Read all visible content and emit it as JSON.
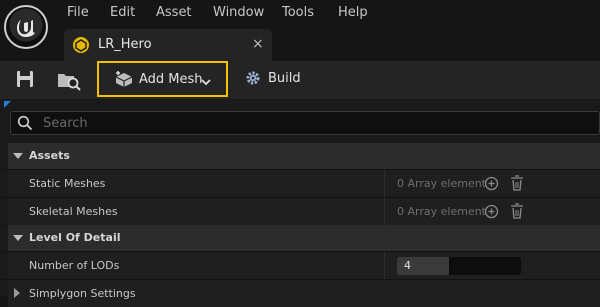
{
  "menu": {
    "items": [
      "File",
      "Edit",
      "Asset",
      "Window",
      "Tools",
      "Help"
    ]
  },
  "tab": {
    "label": "LR_Hero",
    "close": "×"
  },
  "toolbar": {
    "add_mesh_label": "Add Mesh",
    "build_label": "Build"
  },
  "details": {
    "search_placeholder": "Search",
    "sections": {
      "assets": "Assets",
      "lod": "Level Of Detail"
    },
    "rows": {
      "static_meshes": {
        "label": "Static Meshes",
        "value": "0 Array element"
      },
      "skeletal_meshes": {
        "label": "Skeletal Meshes",
        "value": "0 Array element"
      },
      "number_of_lods": {
        "label": "Number of LODs",
        "value": "4",
        "slider_fraction": 0.42
      },
      "simplygon": {
        "label": "Simplygon Settings"
      }
    }
  },
  "colors": {
    "highlight": "#f2c200",
    "tab_icon": "#e6b800",
    "accent_corner": "#2b7bd8"
  },
  "icons": [
    "unreal-logo-icon",
    "save-icon",
    "browse-icon",
    "add-mesh-icon",
    "chevron-down-icon",
    "build-gear-icon",
    "search-icon",
    "plus-circle-icon",
    "trash-icon"
  ]
}
